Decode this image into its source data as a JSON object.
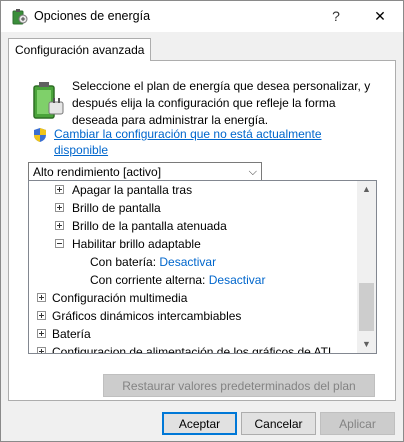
{
  "window": {
    "title": "Opciones de energía",
    "help_glyph": "?",
    "close_glyph": "✕"
  },
  "tab": {
    "label": "Configuración avanzada"
  },
  "intro_text": "Seleccione el plan de energía que desea personalizar, y después elija la configuración que refleje la forma deseada para administrar la energía.",
  "change_link": "Cambiar la configuración que no está actualmente disponible",
  "plan": {
    "selected": "Alto rendimiento [activo]"
  },
  "tree": {
    "items": [
      {
        "label": "Apagar la pantalla tras",
        "expander": "plus"
      },
      {
        "label": "Brillo de pantalla",
        "expander": "plus"
      },
      {
        "label": "Brillo de la pantalla atenuada",
        "expander": "plus"
      },
      {
        "label": "Habilitar brillo adaptable",
        "expander": "minus"
      },
      {
        "label": "Con batería:",
        "value": "Desactivar"
      },
      {
        "label": "Con corriente alterna:",
        "value": "Desactivar"
      },
      {
        "label": "Configuración multimedia",
        "expander": "plus"
      },
      {
        "label": "Gráficos dinámicos intercambiables",
        "expander": "plus"
      },
      {
        "label": "Batería",
        "expander": "plus"
      },
      {
        "label": "Configuracion de alimentación de los gráficos de ATI",
        "expander": "plus"
      }
    ]
  },
  "buttons": {
    "restore": "Restaurar valores predeterminados del plan",
    "accept": "Aceptar",
    "cancel": "Cancelar",
    "apply": "Aplicar"
  },
  "colors": {
    "link": "#0066cc",
    "focus_border": "#0078d7"
  },
  "icons": {
    "title": "power-options-icon",
    "battery": "battery-plug-icon",
    "shield": "uac-shield-icon"
  }
}
